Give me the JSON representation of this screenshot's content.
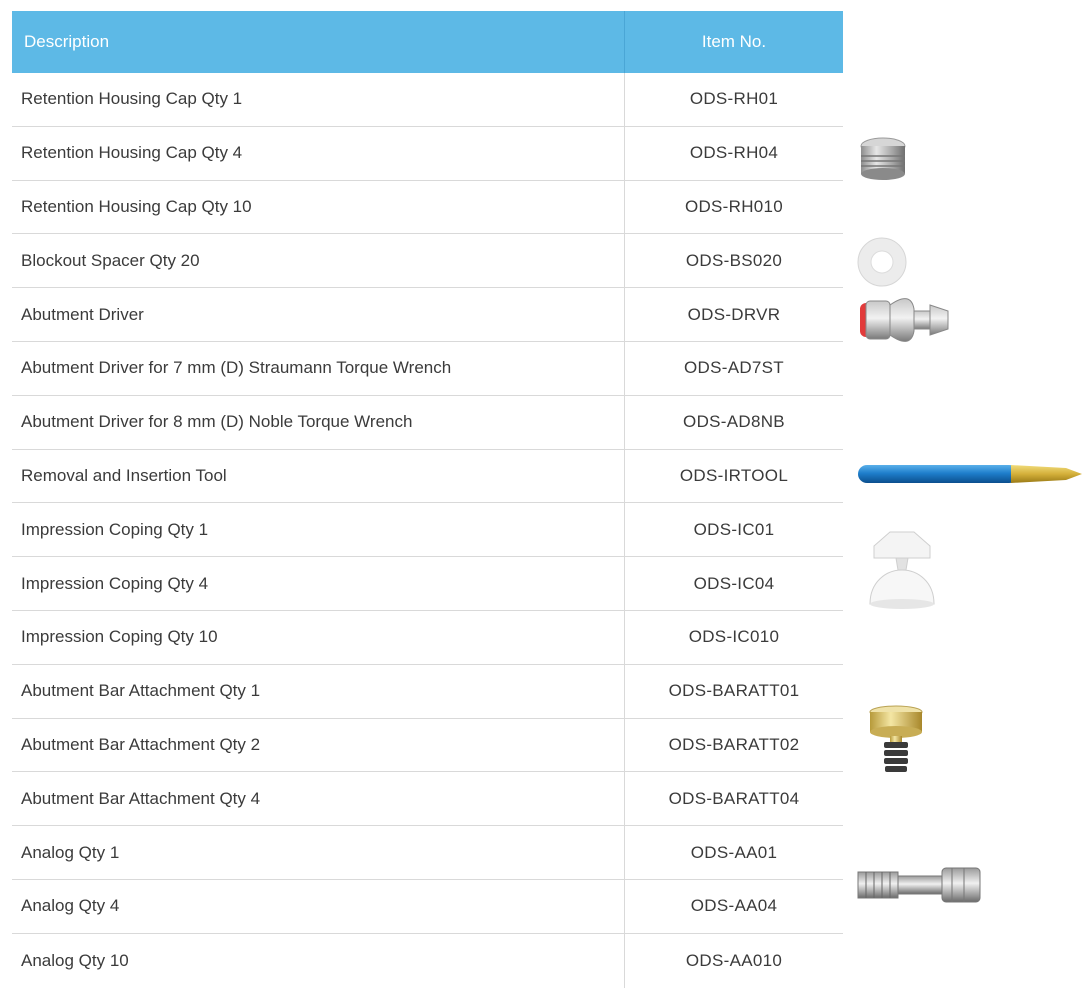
{
  "table": {
    "headers": {
      "description": "Description",
      "item_no": "Item No."
    },
    "rows": [
      {
        "description": "Retention Housing Cap Qty 1",
        "item_no": "ODS-RH01"
      },
      {
        "description": "Retention Housing Cap Qty 4",
        "item_no": "ODS-RH04"
      },
      {
        "description": "Retention Housing Cap Qty 10",
        "item_no": "ODS-RH010"
      },
      {
        "description": "Blockout Spacer Qty 20",
        "item_no": "ODS-BS020"
      },
      {
        "description": "Abutment Driver",
        "item_no": "ODS-DRVR"
      },
      {
        "description": "Abutment Driver for 7 mm (D) Straumann Torque Wrench",
        "item_no": "ODS-AD7ST"
      },
      {
        "description": "Abutment Driver for 8 mm (D) Noble Torque Wrench",
        "item_no": "ODS-AD8NB"
      },
      {
        "description": "Removal and Insertion Tool",
        "item_no": "ODS-IRTOOL"
      },
      {
        "description": "Impression Coping Qty 1",
        "item_no": "ODS-IC01"
      },
      {
        "description": "Impression Coping Qty 4",
        "item_no": "ODS-IC04"
      },
      {
        "description": "Impression Coping Qty 10",
        "item_no": "ODS-IC010"
      },
      {
        "description": "Abutment Bar Attachment Qty 1",
        "item_no": "ODS-BARATT01"
      },
      {
        "description": "Abutment Bar Attachment Qty 2",
        "item_no": "ODS-BARATT02"
      },
      {
        "description": "Abutment Bar Attachment Qty 4",
        "item_no": "ODS-BARATT04"
      },
      {
        "description": "Analog Qty 1",
        "item_no": "ODS-AA01"
      },
      {
        "description": "Analog Qty 4",
        "item_no": "ODS-AA04"
      },
      {
        "description": "Analog Qty 10",
        "item_no": "ODS-AA010"
      }
    ]
  },
  "colors": {
    "header_bg": "#5db9e6",
    "border": "#d9d9d9",
    "text": "#3b3b3b"
  }
}
